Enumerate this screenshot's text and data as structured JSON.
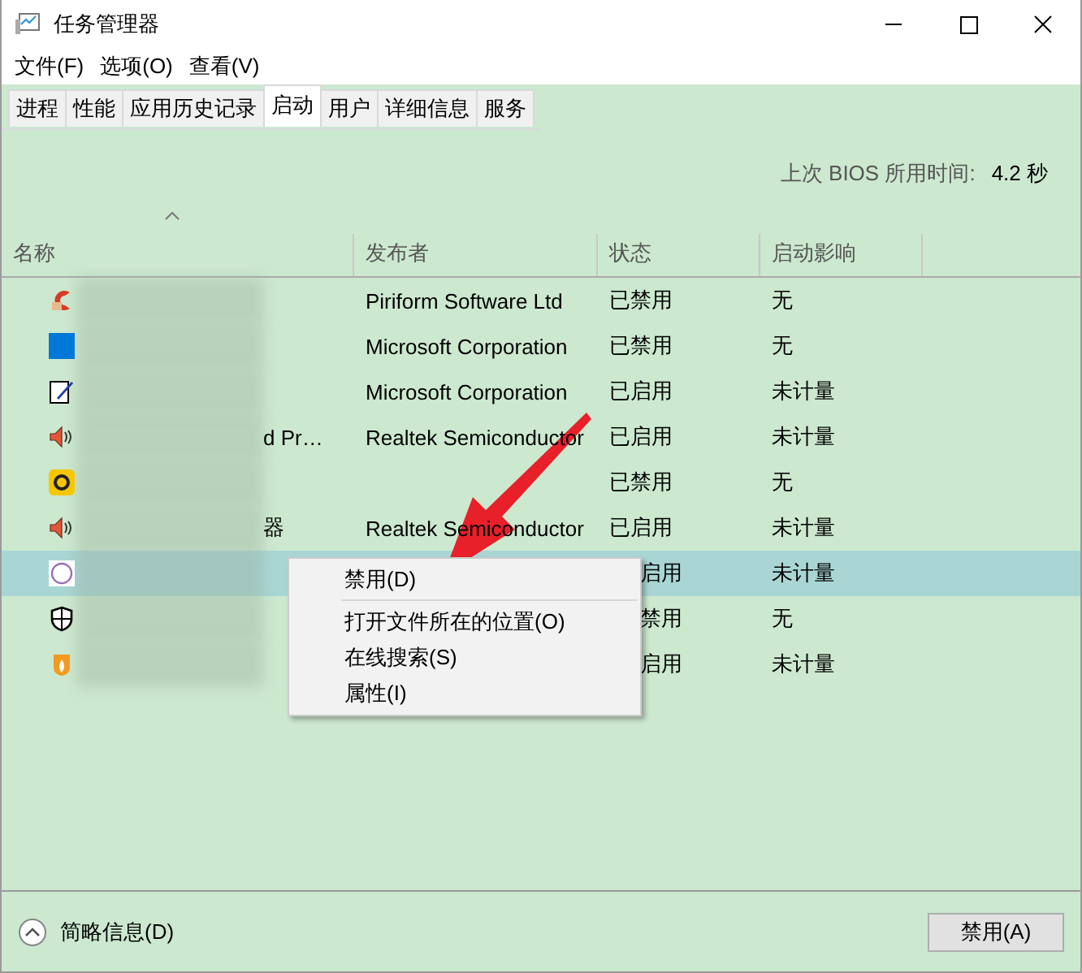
{
  "window": {
    "title": "任务管理器"
  },
  "menu_bar": [
    "文件(F)",
    "选项(O)",
    "查看(V)"
  ],
  "tabs": [
    {
      "label": "进程",
      "selected": false
    },
    {
      "label": "性能",
      "selected": false
    },
    {
      "label": "应用历史记录",
      "selected": false
    },
    {
      "label": "启动",
      "selected": true
    },
    {
      "label": "用户",
      "selected": false
    },
    {
      "label": "详细信息",
      "selected": false
    },
    {
      "label": "服务",
      "selected": false
    }
  ],
  "bios_time": {
    "label": "上次 BIOS 所用时间:",
    "value": "4.2 秒"
  },
  "table": {
    "columns": [
      "名称",
      "发布者",
      "状态",
      "启动影响"
    ],
    "rows": [
      {
        "name": "",
        "publisher": "Piriform Software Ltd",
        "status": "已禁用",
        "impact": "无",
        "selected": false
      },
      {
        "name": "",
        "publisher": "Microsoft Corporation",
        "status": "已禁用",
        "impact": "无",
        "selected": false
      },
      {
        "name": "",
        "publisher": "Microsoft Corporation",
        "status": "已启用",
        "impact": "未计量",
        "selected": false
      },
      {
        "name": "d Pr…",
        "publisher": "Realtek Semiconductor",
        "status": "已启用",
        "impact": "未计量",
        "selected": false
      },
      {
        "name": "",
        "publisher": "",
        "status": "已禁用",
        "impact": "无",
        "selected": false
      },
      {
        "name": "器",
        "publisher": "Realtek Semiconductor",
        "status": "已启用",
        "impact": "未计量",
        "selected": false
      },
      {
        "name": "",
        "publisher": "",
        "status": "启用",
        "impact": "未计量",
        "selected": true
      },
      {
        "name": "",
        "publisher": "",
        "status": "禁用",
        "impact": "无",
        "selected": false
      },
      {
        "name": "",
        "publisher": "",
        "status": "启用",
        "impact": "未计量",
        "selected": false
      }
    ]
  },
  "context_menu": [
    {
      "label": "禁用(D)",
      "separator_after": true
    },
    {
      "label": "打开文件所在的位置(O)",
      "separator_after": false
    },
    {
      "label": "在线搜索(S)",
      "separator_after": false
    },
    {
      "label": "属性(I)",
      "separator_after": false
    }
  ],
  "footer": {
    "details": "简略信息(D)",
    "button": "禁用(A)"
  }
}
